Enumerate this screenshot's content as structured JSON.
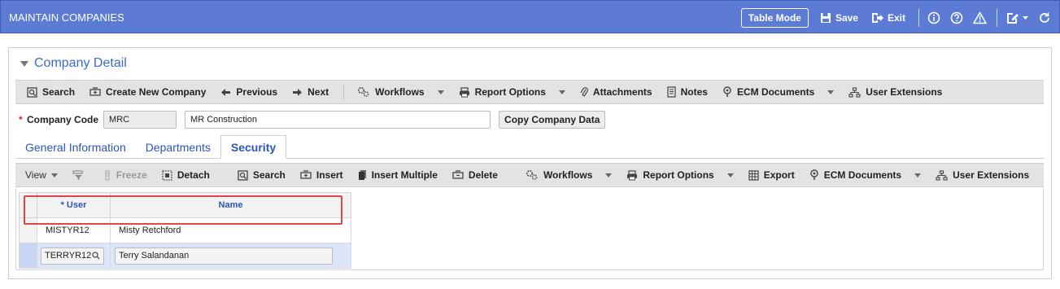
{
  "app": {
    "title": "MAINTAIN COMPANIES",
    "table_mode_label": "Table Mode",
    "save_label": "Save",
    "exit_label": "Exit"
  },
  "section": {
    "title": "Company Detail"
  },
  "main_toolbar": {
    "search": "Search",
    "create_new": "Create New Company",
    "previous": "Previous",
    "next": "Next",
    "workflows": "Workflows",
    "report_options": "Report Options",
    "attachments": "Attachments",
    "notes": "Notes",
    "ecm_documents": "ECM Documents",
    "user_extensions": "User Extensions"
  },
  "company": {
    "code_label": "Company Code",
    "required_mark": "*",
    "code_value": "MRC",
    "name_value": "MR Construction",
    "copy_button": "Copy Company Data"
  },
  "tabs": [
    {
      "label": "General Information"
    },
    {
      "label": "Departments"
    },
    {
      "label": "Security"
    }
  ],
  "grid_toolbar": {
    "view": "View",
    "freeze": "Freeze",
    "detach": "Detach",
    "search": "Search",
    "insert": "Insert",
    "insert_multiple": "Insert Multiple",
    "delete": "Delete",
    "workflows": "Workflows",
    "report_options": "Report Options",
    "export": "Export",
    "ecm_documents": "ECM Documents",
    "user_extensions": "User Extensions"
  },
  "grid": {
    "columns": {
      "user": "* User",
      "name": "Name"
    },
    "rows": [
      {
        "user": "MISTYR12",
        "name": "Misty Retchford"
      },
      {
        "user": "TERRYR12",
        "name": "Terry Salandanan"
      }
    ]
  },
  "colors": {
    "titlebar": "#5b7bd5",
    "link_blue": "#2b56b8",
    "highlight": "#e0474c"
  }
}
